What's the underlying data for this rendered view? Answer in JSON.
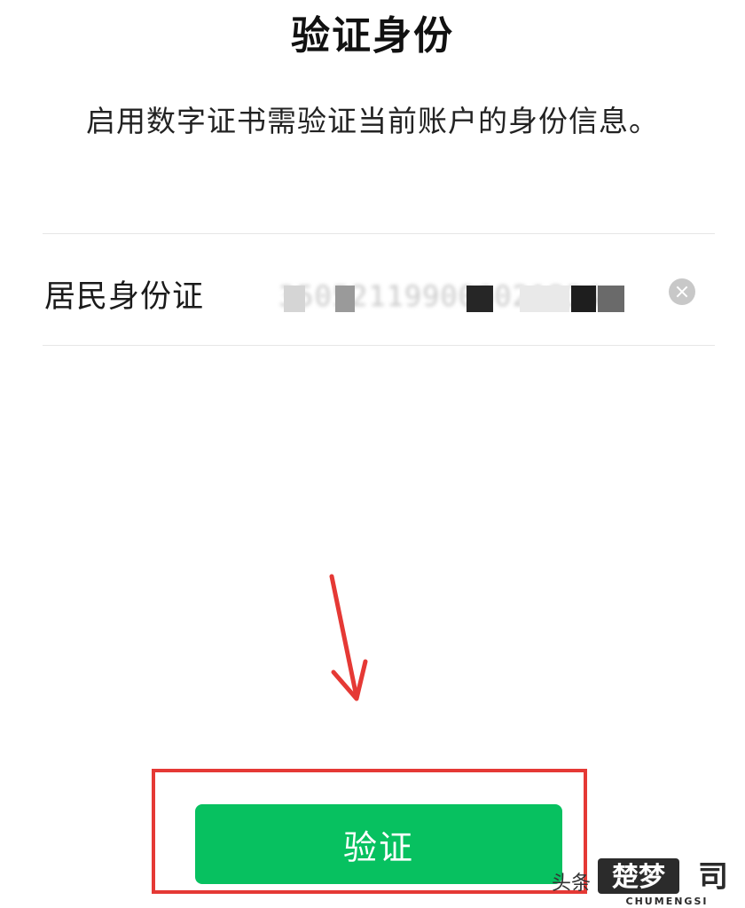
{
  "page": {
    "title": "验证身份",
    "subtitle": "启用数字证书需验证当前账户的身份信息。"
  },
  "id_field": {
    "label": "居民身份证",
    "value": "350521199006021234"
  },
  "icons": {
    "clear": "clear-circle-icon",
    "annotation": "red-arrow-down-icon"
  },
  "actions": {
    "verify_label": "验证"
  },
  "watermark": {
    "prefix": "头条",
    "brand": "楚梦",
    "brand_latin": "CHUMENGSI"
  },
  "colors": {
    "primary_button": "#07c160",
    "annotation": "#e53935",
    "clear_icon": "#c8c8c8"
  }
}
